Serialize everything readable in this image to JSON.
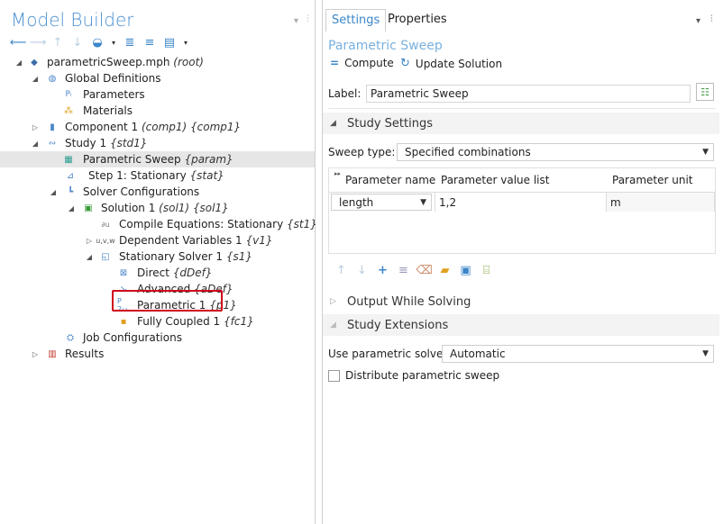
{
  "left_panel": {
    "title": "Model Builder",
    "tree": [
      {
        "label": "parametricSweep.mph",
        "tag": "(root)",
        "icon": "mph-file-icon"
      },
      {
        "label": "Global Definitions",
        "tag": "",
        "icon": "globe-icon"
      },
      {
        "label": "Parameters",
        "tag": "",
        "icon": "parameters-icon"
      },
      {
        "label": "Materials",
        "tag": "",
        "icon": "materials-icon"
      },
      {
        "label": "Component 1",
        "tag": "(comp1) {comp1}",
        "icon": "component-icon"
      },
      {
        "label": "Study 1",
        "tag": "{std1}",
        "icon": "study-icon"
      },
      {
        "label": "Parametric Sweep",
        "tag": "{param}",
        "icon": "parametric-sweep-icon"
      },
      {
        "label": "Step 1: Stationary",
        "tag": "{stat}",
        "icon": "stationary-step-icon"
      },
      {
        "label": "Solver Configurations",
        "tag": "",
        "icon": "solver-configurations-icon"
      },
      {
        "label": "Solution 1",
        "tag": "(sol1) {sol1}",
        "icon": "solution-icon"
      },
      {
        "label": "Compile Equations: Stationary",
        "tag": "{st1}",
        "icon": "compile-equations-icon"
      },
      {
        "label": "Dependent Variables 1",
        "tag": "{v1}",
        "icon": "dependent-variables-icon"
      },
      {
        "label": "Stationary Solver 1",
        "tag": "{s1}",
        "icon": "stationary-solver-icon"
      },
      {
        "label": "Direct",
        "tag": "{dDef}",
        "icon": "direct-icon"
      },
      {
        "label": "Advanced",
        "tag": "{aDef}",
        "icon": "advanced-icon"
      },
      {
        "label": "Parametric 1",
        "tag": "{p1}",
        "icon": "parametric-icon"
      },
      {
        "label": "Fully Coupled 1",
        "tag": "{fc1}",
        "icon": "fully-coupled-icon"
      },
      {
        "label": "Job Configurations",
        "tag": "",
        "icon": "job-configurations-icon"
      },
      {
        "label": "Results",
        "tag": "",
        "icon": "results-icon"
      }
    ]
  },
  "right_panel": {
    "tabs": [
      "Settings",
      "Properties"
    ],
    "node_title": "Parametric Sweep",
    "compute_label": "Compute",
    "update_label": "Update Solution",
    "label_caption": "Label:",
    "label_value": "Parametric Sweep",
    "study_settings": "Study Settings",
    "sweep_type_caption": "Sweep type:",
    "sweep_type_value": "Specified combinations",
    "table": {
      "headers": [
        "Parameter name",
        "Parameter value list",
        "Parameter unit"
      ],
      "rows": [
        [
          "length",
          "1,2",
          "m"
        ]
      ]
    },
    "output_while_solving": "Output While Solving",
    "study_extensions": "Study Extensions",
    "use_parametric_solver_caption": "Use parametric solver:",
    "use_parametric_solver_value": "Automatic",
    "distribute_label": "Distribute parametric sweep"
  }
}
